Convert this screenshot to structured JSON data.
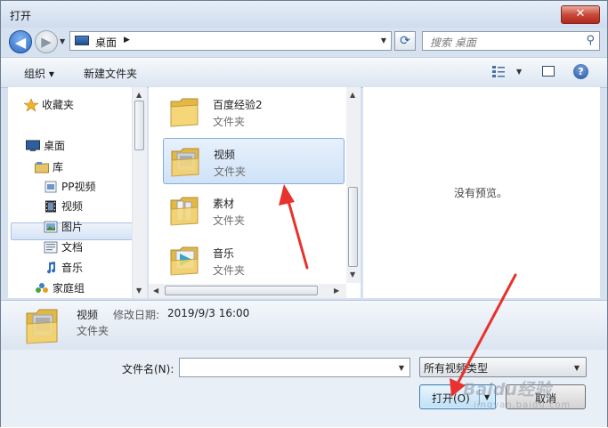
{
  "window": {
    "title": "打开",
    "close_label": "✕"
  },
  "navbar": {
    "address_location": "桌面",
    "search_placeholder": "搜索 桌面"
  },
  "toolbar": {
    "organize_label": "组织 ▾",
    "new_folder_label": "新建文件夹"
  },
  "nav_pane": {
    "items": [
      {
        "label": "收藏夹",
        "icon": "star-icon"
      },
      {
        "label": "桌面",
        "icon": "desktop-icon",
        "selected": true
      },
      {
        "label": "库",
        "icon": "library-icon"
      },
      {
        "label": "PP视频",
        "icon": "video-library-icon"
      },
      {
        "label": "视频",
        "icon": "film-icon"
      },
      {
        "label": "图片",
        "icon": "picture-icon"
      },
      {
        "label": "文档",
        "icon": "document-icon"
      },
      {
        "label": "音乐",
        "icon": "music-note-icon"
      },
      {
        "label": "家庭组",
        "icon": "homegroup-icon"
      }
    ]
  },
  "files": [
    {
      "name": "百度经验2",
      "type": "文件夹"
    },
    {
      "name": "视频",
      "type": "文件夹",
      "selected": true
    },
    {
      "name": "素材",
      "type": "文件夹"
    },
    {
      "name": "音乐",
      "type": "文件夹"
    }
  ],
  "preview": {
    "message": "没有预览。"
  },
  "details": {
    "name": "视频",
    "modified_label": "修改日期:",
    "modified_value": "2019/9/3 16:00",
    "type": "文件夹"
  },
  "bottom": {
    "filename_label": "文件名(N):",
    "filename_value": "",
    "file_type_value": "所有视频类型",
    "open_label": "打开(O)",
    "cancel_label": "取消"
  },
  "watermark": {
    "text": "Baidu经验",
    "sub": "jingyan.baidu.com"
  },
  "colors": {
    "selection": "#cfe2f8",
    "arrow": "#e8322d",
    "accent": "#2b69c7"
  }
}
